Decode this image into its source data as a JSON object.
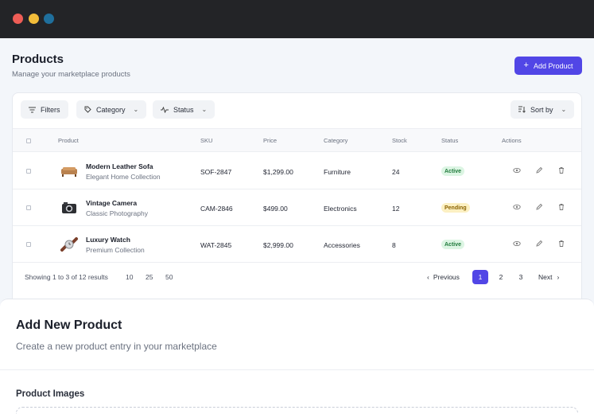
{
  "header": {
    "title": "Products",
    "subtitle": "Manage your marketplace products",
    "add_button_label": "Add Product"
  },
  "filters": {
    "filters_label": "Filters",
    "category_label": "Category",
    "status_label": "Status",
    "sort_label": "Sort by"
  },
  "table": {
    "columns": [
      "Product",
      "SKU",
      "Price",
      "Category",
      "Stock",
      "Status",
      "Actions"
    ],
    "rows": [
      {
        "name": "Modern Leather Sofa",
        "collection": "Elegant Home Collection",
        "sku": "SOF-2847",
        "price": "$1,299.00",
        "category": "Furniture",
        "stock": "24",
        "status": "Active",
        "thumb": "sofa-icon"
      },
      {
        "name": "Vintage Camera",
        "collection": "Classic Photography",
        "sku": "CAM-2846",
        "price": "$499.00",
        "category": "Electronics",
        "stock": "12",
        "status": "Pending",
        "thumb": "camera-icon"
      },
      {
        "name": "Luxury Watch",
        "collection": "Premium Collection",
        "sku": "WAT-2845",
        "price": "$2,999.00",
        "category": "Accessories",
        "stock": "8",
        "status": "Active",
        "thumb": "watch-icon"
      }
    ]
  },
  "pagination": {
    "summary": "Showing 1 to 3 of 12 results",
    "page_sizes": [
      "10",
      "25",
      "50"
    ],
    "previous_label": "Previous",
    "next_label": "Next",
    "pages": [
      "1",
      "2",
      "3"
    ],
    "current_page": "1"
  },
  "add_panel": {
    "title": "Add New Product",
    "subtitle": "Create a new product entry in your marketplace",
    "section_label": "Product Images"
  },
  "colors": {
    "accent": "#5146e6",
    "active_badge": "#dcf5e3",
    "pending_badge": "#fcf0c2"
  }
}
